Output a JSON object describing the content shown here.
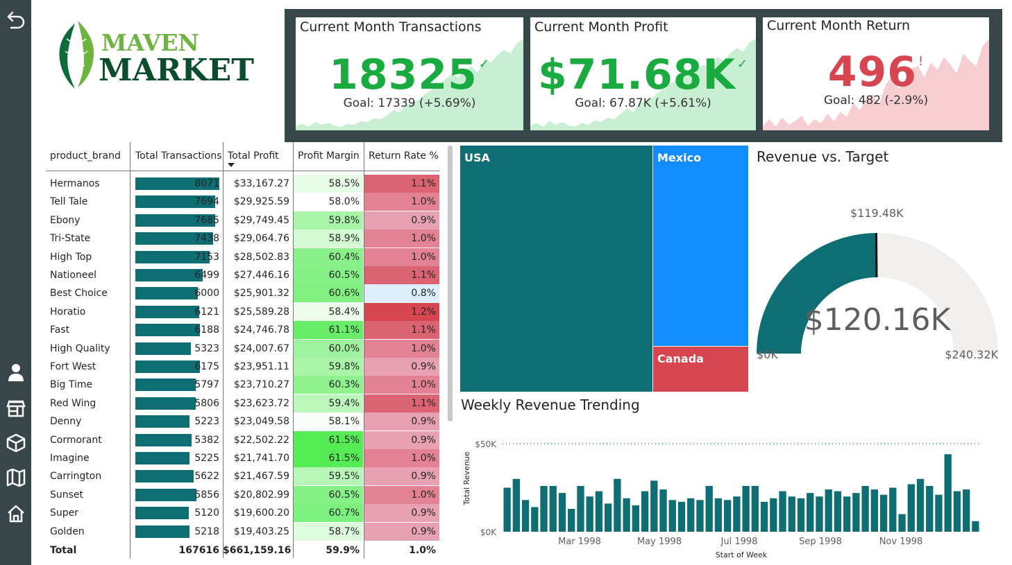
{
  "logo": {
    "line1": "MAVEN",
    "line2": "MARKET"
  },
  "nav": {
    "items": [
      "back-icon",
      "customer-icon",
      "store-icon",
      "product-icon",
      "map-icon",
      "home-icon"
    ]
  },
  "kpis": [
    {
      "title": "Current Month Transactions",
      "value": "18325",
      "flag": "✓",
      "goal": "Goal: 17339 (+5.69%)",
      "status": "good",
      "color": "#1aab40",
      "spark": [
        5,
        7,
        4,
        9,
        6,
        8,
        5,
        4,
        7,
        6,
        10,
        9,
        13,
        12,
        16,
        22,
        20,
        28,
        30,
        34,
        40,
        45,
        50,
        56,
        62,
        58,
        66,
        70,
        63,
        78,
        74,
        82,
        88,
        84,
        95,
        100
      ]
    },
    {
      "title": "Current Month Profit",
      "value": "$71.68K",
      "flag": "✓",
      "goal": "Goal: 67.87K (+5.61%)",
      "status": "good",
      "color": "#1aab40",
      "spark": [
        5,
        8,
        4,
        10,
        6,
        9,
        5,
        4,
        8,
        6,
        11,
        9,
        14,
        12,
        18,
        24,
        20,
        30,
        32,
        36,
        42,
        46,
        52,
        58,
        64,
        60,
        68,
        72,
        65,
        80,
        76,
        84,
        90,
        86,
        96,
        100
      ]
    },
    {
      "title": "Current Month Return",
      "value": "496",
      "flag": "!",
      "goal": "Goal: 482 (-2.9%)",
      "status": "bad",
      "color": "#d64550",
      "spark": [
        5,
        12,
        4,
        14,
        6,
        10,
        16,
        5,
        12,
        8,
        18,
        10,
        20,
        15,
        30,
        22,
        35,
        40,
        28,
        50,
        60,
        45,
        55,
        68,
        70,
        58,
        74,
        66,
        80,
        72,
        62,
        84,
        76,
        70,
        92,
        100
      ]
    }
  ],
  "table": {
    "headers": [
      "product_brand",
      "Total Transactions",
      "Total Profit",
      "Profit Margin",
      "Return Rate %"
    ],
    "sort_icon": "sort-descending-icon",
    "rows": [
      {
        "brand": "Hermanos",
        "transactions": "8071",
        "profit": "$33,167.27",
        "margin": "58.5%",
        "return": "1.1%"
      },
      {
        "brand": "Tell Tale",
        "transactions": "7694",
        "profit": "$29,925.59",
        "margin": "58.0%",
        "return": "1.0%"
      },
      {
        "brand": "Ebony",
        "transactions": "7685",
        "profit": "$29,749.45",
        "margin": "59.8%",
        "return": "0.9%"
      },
      {
        "brand": "Tri-State",
        "transactions": "7438",
        "profit": "$29,064.76",
        "margin": "58.9%",
        "return": "1.0%"
      },
      {
        "brand": "High Top",
        "transactions": "7153",
        "profit": "$28,502.83",
        "margin": "60.4%",
        "return": "1.0%"
      },
      {
        "brand": "Nationeel",
        "transactions": "6499",
        "profit": "$27,446.16",
        "margin": "60.5%",
        "return": "1.1%"
      },
      {
        "brand": "Best Choice",
        "transactions": "6000",
        "profit": "$25,901.32",
        "margin": "60.6%",
        "return": "0.8%"
      },
      {
        "brand": "Horatio",
        "transactions": "6121",
        "profit": "$25,589.28",
        "margin": "58.4%",
        "return": "1.2%"
      },
      {
        "brand": "Fast",
        "transactions": "6188",
        "profit": "$24,746.78",
        "margin": "61.1%",
        "return": "1.1%"
      },
      {
        "brand": "High Quality",
        "transactions": "5323",
        "profit": "$24,007.67",
        "margin": "60.0%",
        "return": "1.0%"
      },
      {
        "brand": "Fort West",
        "transactions": "6175",
        "profit": "$23,951.11",
        "margin": "59.8%",
        "return": "0.9%"
      },
      {
        "brand": "Big Time",
        "transactions": "5797",
        "profit": "$23,710.27",
        "margin": "60.3%",
        "return": "1.0%"
      },
      {
        "brand": "Red Wing",
        "transactions": "5806",
        "profit": "$23,623.72",
        "margin": "59.4%",
        "return": "1.1%"
      },
      {
        "brand": "Denny",
        "transactions": "5223",
        "profit": "$23,049.58",
        "margin": "58.1%",
        "return": "0.9%"
      },
      {
        "brand": "Cormorant",
        "transactions": "5382",
        "profit": "$22,502.22",
        "margin": "61.5%",
        "return": "0.9%"
      },
      {
        "brand": "Imagine",
        "transactions": "5225",
        "profit": "$21,741.70",
        "margin": "61.5%",
        "return": "1.0%"
      },
      {
        "brand": "Carrington",
        "transactions": "5622",
        "profit": "$21,467.59",
        "margin": "59.5%",
        "return": "0.9%"
      },
      {
        "brand": "Sunset",
        "transactions": "5856",
        "profit": "$20,802.99",
        "margin": "60.5%",
        "return": "1.0%"
      },
      {
        "brand": "Super",
        "transactions": "5120",
        "profit": "$19,600.20",
        "margin": "60.7%",
        "return": "0.9%"
      },
      {
        "brand": "Golden",
        "transactions": "5218",
        "profit": "$19,403.25",
        "margin": "58.7%",
        "return": "0.9%"
      }
    ],
    "total": {
      "label": "Total",
      "transactions": "167616",
      "profit": "$661,159.16",
      "margin": "59.9%",
      "return": "1.0%"
    }
  },
  "treemap": {
    "tiles": [
      {
        "label": "USA",
        "color": "#0f6e74"
      },
      {
        "label": "Mexico",
        "color": "#118dff"
      },
      {
        "label": "Canada",
        "color": "#d64550"
      }
    ]
  },
  "gauge": {
    "title": "Revenue vs. Target",
    "value": 120.16,
    "value_label": "$120.16K",
    "target": 119.48,
    "target_label": "$119.48K",
    "min_label": "$0K",
    "max": 240.32,
    "max_label": "$240.32K",
    "fill_color": "#0f6e74"
  },
  "trend": {
    "title": "Weekly Revenue Trending",
    "xlabel": "Start of Week",
    "ylabel": "Total Revenue",
    "yticks": [
      "$0K",
      "$50K"
    ],
    "xticks": [
      "Mar 1998",
      "May 1998",
      "Jul 1998",
      "Sep 1998",
      "Nov 1998"
    ]
  },
  "chart_data": {
    "type": "bar",
    "title": "Weekly Revenue Trending",
    "xlabel": "Start of Week",
    "ylabel": "Total Revenue",
    "ylim": [
      0,
      50000
    ],
    "x_range": [
      "1998-01-04",
      "1998-12-27"
    ],
    "categories": [
      "1998-01-04",
      "1998-01-11",
      "1998-01-18",
      "1998-01-25",
      "1998-02-01",
      "1998-02-08",
      "1998-02-15",
      "1998-02-22",
      "1998-03-01",
      "1998-03-08",
      "1998-03-15",
      "1998-03-22",
      "1998-03-29",
      "1998-04-05",
      "1998-04-12",
      "1998-04-19",
      "1998-04-26",
      "1998-05-03",
      "1998-05-10",
      "1998-05-17",
      "1998-05-24",
      "1998-05-31",
      "1998-06-07",
      "1998-06-14",
      "1998-06-21",
      "1998-06-28",
      "1998-07-05",
      "1998-07-12",
      "1998-07-19",
      "1998-07-26",
      "1998-08-02",
      "1998-08-09",
      "1998-08-16",
      "1998-08-23",
      "1998-08-30",
      "1998-09-06",
      "1998-09-13",
      "1998-09-20",
      "1998-09-27",
      "1998-10-04",
      "1998-10-11",
      "1998-10-18",
      "1998-10-25",
      "1998-11-01",
      "1998-11-08",
      "1998-11-15",
      "1998-11-22",
      "1998-11-29",
      "1998-12-06",
      "1998-12-13",
      "1998-12-20",
      "1998-12-27"
    ],
    "values": [
      25000,
      30000,
      18000,
      14000,
      26000,
      26000,
      22000,
      13000,
      26000,
      20000,
      23000,
      16000,
      30000,
      19000,
      15000,
      23000,
      29000,
      24000,
      18000,
      17000,
      19000,
      18000,
      26000,
      19000,
      18000,
      20000,
      26000,
      26000,
      17000,
      19000,
      23000,
      20000,
      19000,
      22000,
      20000,
      24000,
      23000,
      20000,
      22000,
      26000,
      24000,
      21000,
      25000,
      10000,
      27000,
      30000,
      26000,
      21000,
      44000,
      23000,
      24000,
      6000
    ]
  }
}
